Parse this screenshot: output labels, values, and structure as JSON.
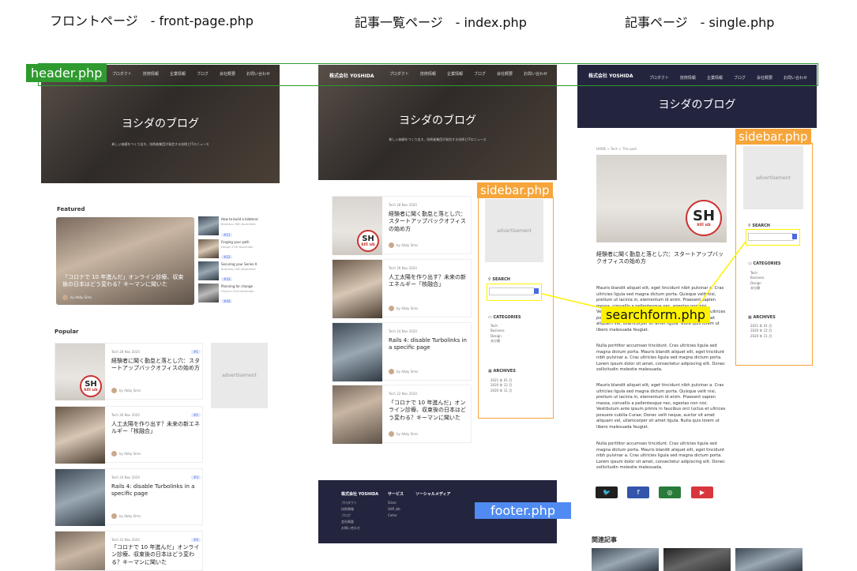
{
  "columns": [
    {
      "title": "フロントページ　- front-page.php"
    },
    {
      "title": "記事一覧ページ　- index.php"
    },
    {
      "title": "記事ページ　- single.php"
    }
  ],
  "labels": {
    "header": "header.php",
    "sidebar": "sidebar.php",
    "searchform": "searchform.php",
    "footer": "footer.php"
  },
  "site": {
    "brand": "株式会社 YOSHIDA",
    "blog_title": "ヨシダのブログ",
    "hero_sub": "新しい価値をつくり出す。技術者集団が発信する技術とITのニュース",
    "nav": [
      "プロダクト",
      "技術情報",
      "企業情報",
      "ブログ",
      "会社概要",
      "お問い合わせ"
    ]
  },
  "front": {
    "featured_h": "Featured",
    "featured_caption": "「コロナで 10 年進んだ」オンライン診療、収束後の日本はどう変わる？キーマンに聞いた",
    "featured_author": "by Abby Sims",
    "featured_side": [
      {
        "title": "How to build a bilateral",
        "cat": "Business",
        "date": "28th November",
        "badge": "#11"
      },
      {
        "title": "Forging your path",
        "cat": "Design",
        "date": "27th November",
        "badge": "#22"
      },
      {
        "title": "Securing your Series A",
        "cat": "Business",
        "date": "25th November",
        "badge": "#33"
      },
      {
        "title": "Planning for change",
        "cat": "Finance",
        "date": "21st November",
        "badge": "#44"
      }
    ],
    "popular_h": "Popular"
  },
  "posts": [
    {
      "cat": "Tech",
      "date": "28 Nov 2020",
      "title": "経験者に聞く勤怠と落とし穴：スタートアップバックオフィスの始め方",
      "author": "by Abby Sims",
      "badge": "#1"
    },
    {
      "cat": "Tech",
      "date": "26 Nov 2020",
      "title": "人工太陽を作り出す？未来の新エネルギー「核融合」",
      "author": "by Abby Sims",
      "badge": "#2"
    },
    {
      "cat": "Tech",
      "date": "24 Nov 2020",
      "title": "Rails 4: disable Turbolinks in a specific page",
      "author": "by Abby Sims",
      "badge": "#3"
    },
    {
      "cat": "Tech",
      "date": "22 Nov 2020",
      "title": "「コロナで 10 年進んだ」オンライン診療、収束後の日本はどう変わる？キーマンに聞いた",
      "author": "by Abby Sims",
      "badge": "#4"
    }
  ],
  "sidebar": {
    "ad": "advertisement",
    "search_h": "SEARCH",
    "categories_h": "CATEGORIES",
    "categories": [
      "Tech",
      "Business",
      "Design",
      "未分類"
    ],
    "archives_h": "ARCHIVES",
    "archives": [
      "2021 年 01 月",
      "2020 年 12 月",
      "2020 年 11 月"
    ]
  },
  "footer": {
    "brand": "株式会社 YOSHIDA",
    "col1": [
      "プロダクト",
      "技術情報",
      "ブログ",
      "会社概要",
      "お問い合わせ"
    ],
    "col2_h": "サービス",
    "col2": [
      "Slicer",
      "SHR job",
      "Cellar"
    ],
    "col3_h": "ソーシャルメディア"
  },
  "single": {
    "breadcrumb": "HOME > Tech > This post",
    "post_title": "経験者に聞く勤怠と落とし穴：スタートアップバックオフィスの始め方",
    "para1": "Mauris blandit aliquet elit, eget tincidunt nibh pulvinar a. Cras ultricies ligula sed magna dictum porta. Quisque velit nisi, pretium ut lacinia in, elementum id enim. Praesent sapien massa, convallis a pellentesque nec, egestas non nisi. Vestibulum ante ipsum primis in faucibus orci luctus et ultrices posuere cubilia Curae; Donec velit neque, auctor sit amet aliquam vel, ullamcorper sit amet ligula. Nulla quis lorem ut libero malesuada feugiat.",
    "para2": "Nulla porttitor accumsan tincidunt. Cras ultricies ligula sed magna dictum porta. Mauris blandit aliquet elit, eget tincidunt nibh pulvinar a. Cras ultricies ligula sed magna dictum porta. Lorem ipsum dolor sit amet, consectetur adipiscing elit. Donec sollicitudin molestie malesuada.",
    "related_h": "関連記事",
    "social": [
      {
        "icon": "twitter-icon",
        "color": "#1f1f1f"
      },
      {
        "icon": "facebook-icon",
        "color": "#3355aa"
      },
      {
        "icon": "line-icon",
        "color": "#2a7a3a"
      },
      {
        "icon": "youtube-icon",
        "color": "#d9363e"
      }
    ]
  },
  "sh_logo": {
    "big": "SH",
    "small": "kill ub"
  },
  "colors": {
    "header_frame": "#2f9a2f",
    "sidebar_frame": "#f6a53a",
    "searchform": "#fff200",
    "footer_label": "#4f8bf2",
    "navy": "#23253f"
  }
}
